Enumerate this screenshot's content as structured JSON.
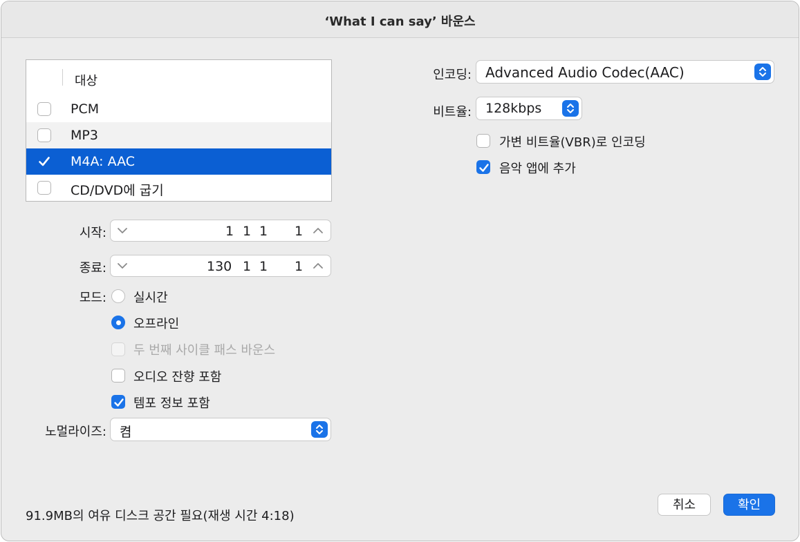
{
  "title": "‘What I can say’ 바운스",
  "destination": {
    "header": "대상",
    "rows": [
      {
        "label": "PCM",
        "checked": false
      },
      {
        "label": "MP3",
        "checked": false
      },
      {
        "label": "M4A: AAC",
        "checked": true
      },
      {
        "label": "CD/DVD에 굽기",
        "checked": false
      }
    ]
  },
  "start": {
    "label": "시작:",
    "v1": "1",
    "v2": "1",
    "v3": "1",
    "v4": "1"
  },
  "end": {
    "label": "종료:",
    "v1": "130",
    "v2": "1",
    "v3": "1",
    "v4": "1"
  },
  "mode": {
    "label": "모드:",
    "realtime": "실시간",
    "offline": "오프라인",
    "selected": "offline"
  },
  "options": {
    "second_cycle": "두 번째 사이클 패스 바운스",
    "audio_tail": "오디오 잔향 포함",
    "tempo_info": "템포 정보 포함",
    "second_cycle_checked": false,
    "audio_tail_checked": false,
    "tempo_info_checked": true
  },
  "normalize": {
    "label": "노멀라이즈:",
    "value": "켬"
  },
  "encoding": {
    "label": "인코딩:",
    "value": "Advanced Audio Codec(AAC)"
  },
  "bitrate": {
    "label": "비트율:",
    "value": "128kbps"
  },
  "vbr": {
    "label": "가변 비트율(VBR)로 인코딩",
    "checked": false
  },
  "add_music": {
    "label": "음악 앱에 추가",
    "checked": true
  },
  "status": "91.9MB의 여유 디스크 공간 필요(재생 시간 4:18)",
  "buttons": {
    "cancel": "취소",
    "ok": "확인"
  },
  "colors": {
    "accent": "#1a73e8",
    "selection": "#0b5fd3"
  }
}
